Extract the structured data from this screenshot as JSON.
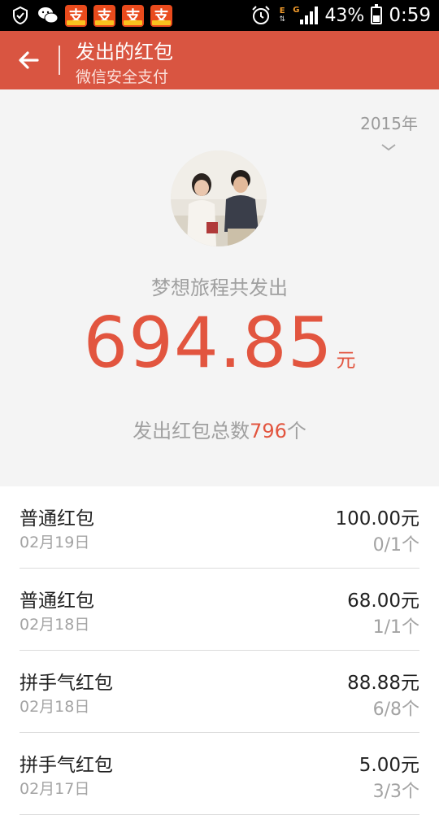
{
  "status_bar": {
    "battery": "43%",
    "time": "0:59",
    "net_type_1": "E",
    "net_type_2": "G",
    "app_icons": [
      "alipay-icon",
      "alipay-icon",
      "alipay-icon",
      "alipay-icon"
    ],
    "app_icon_glyph": "支"
  },
  "header": {
    "title": "发出的红包",
    "subtitle": "微信安全支付",
    "color": "#d95541"
  },
  "summary": {
    "year": "2015年",
    "label": "梦想旅程共发出",
    "amount": "694.85",
    "unit": "元",
    "count_prefix": "发出红包总数",
    "count": "796",
    "count_suffix": "个",
    "accent": "#e2553f"
  },
  "records": [
    {
      "name": "普通红包",
      "date": "02月19日",
      "amount": "100.00元",
      "count": "0/1个"
    },
    {
      "name": "普通红包",
      "date": "02月18日",
      "amount": "68.00元",
      "count": "1/1个"
    },
    {
      "name": "拼手气红包",
      "date": "02月18日",
      "amount": "88.88元",
      "count": "6/8个"
    },
    {
      "name": "拼手气红包",
      "date": "02月17日",
      "amount": "5.00元",
      "count": "3/3个"
    }
  ]
}
